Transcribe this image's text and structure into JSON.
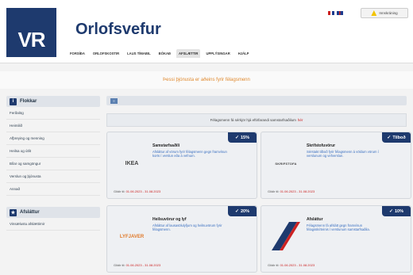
{
  "header": {
    "logo": "VR",
    "title": "Orlofsvefur",
    "nav": [
      "FORSÍÐA",
      "ORLOFSKOSTIR",
      "LAUS TÍMABIL",
      "BÓKAÐ",
      "AFSLÆTTIR",
      "UPPLÝSINGAR",
      "HJÁLP"
    ],
    "active_nav": "AFSLÆTTIR",
    "top_button": "Innskráning",
    "accent": "#1e3a6e"
  },
  "notice": "Þessi þjónusta er aðeins fyrir félagsmenn",
  "sidebar": {
    "section1": "Flokkar",
    "items": [
      "Ferðalög",
      "Heimilið",
      "Afþreying og menning",
      "Heilsa og útlit",
      "Bílar og samgöngur",
      "Verslun og þjónusta",
      "Annað"
    ],
    "section2": "Afsláttur",
    "items2": [
      "Vinsælustu afslættirnir"
    ]
  },
  "main": {
    "bar_icon": "list-icon",
    "info": "Félagsmenn fá sérkjör hjá eftirfarandi samstarfsaðilum",
    "info_link": "hér",
    "cards": [
      {
        "badge": "15%",
        "logo": "IKEA",
        "name": "Samstarfsaðili",
        "desc": "Afsláttur af vörum fyrir félagsmenn gegn framvísun korts í verslun eða á vefnum.",
        "footer_label": "Gildir til:",
        "dates": "01.06.2023 - 31.08.2023"
      },
      {
        "badge": "Tilboð",
        "logo": "SKRIFSTOFA",
        "name": "Skrifstofuvörur",
        "desc": "Sérstakt tilboð fyrir félagsmenn á völdum vörum í verslunum og vefverslun.",
        "footer_label": "Gildir til:",
        "dates": "01.06.2023 - 31.08.2023"
      },
      {
        "badge": "20%",
        "logo": "LYFJAVER",
        "name": "Heilsuvörur og lyf",
        "desc": "Afsláttur af lausasölulyfjum og heilsuvörum fyrir félagsmenn.",
        "footer_label": "Gildir til:",
        "dates": "01.06.2023 - 31.08.2023"
      },
      {
        "badge": "10%",
        "logo": "Afsláttur",
        "name": "Afsláttur",
        "desc": "Félagsmenn fá afslátt gegn framvísun félagsskírteinis í verslunum samstarfsaðila.",
        "footer_label": "Gildir til:",
        "dates": "01.06.2023 - 31.08.2023"
      }
    ]
  }
}
